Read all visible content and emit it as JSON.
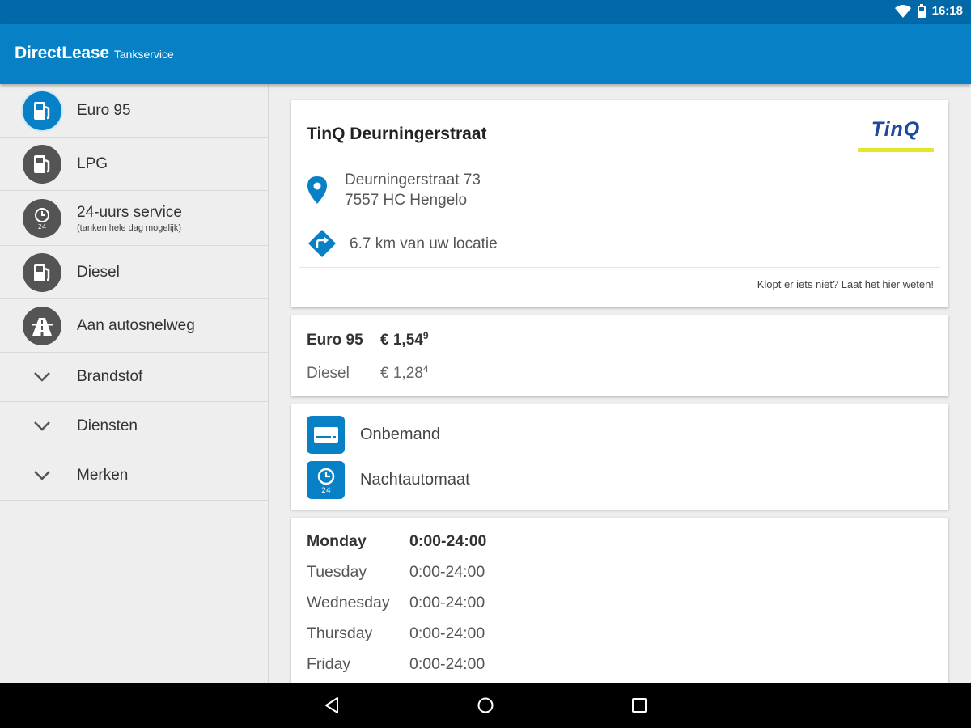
{
  "status_bar": {
    "time": "16:18"
  },
  "app_bar": {
    "brand": "DirectLease",
    "subtitle": "Tankservice"
  },
  "sidebar": {
    "filters": [
      {
        "label": "Euro 95",
        "icon": "fuel-pump-icon",
        "active": true
      },
      {
        "label": "LPG",
        "icon": "fuel-pump-icon",
        "active": false
      },
      {
        "label": "24-uurs service",
        "sublabel": "(tanken hele dag mogelijk)",
        "icon": "clock-24-icon",
        "active": false
      },
      {
        "label": "Diesel",
        "icon": "fuel-pump-icon",
        "active": false
      },
      {
        "label": "Aan autosnelweg",
        "icon": "highway-icon",
        "active": false
      }
    ],
    "sections": [
      {
        "label": "Brandstof"
      },
      {
        "label": "Diensten"
      },
      {
        "label": "Merken"
      }
    ]
  },
  "station": {
    "name": "TinQ Deurningerstraat",
    "logo_text": "TinQ",
    "address_line1": "Deurningerstraat 73",
    "address_line2": "7557 HC  Hengelo",
    "distance": "6.7 km van uw locatie",
    "feedback": "Klopt er iets niet? Laat het hier weten!"
  },
  "prices": [
    {
      "fuel": "Euro 95",
      "price": "€ 1,54",
      "tenth": "9"
    },
    {
      "fuel": "Diesel",
      "price": "€ 1,28",
      "tenth": "4"
    }
  ],
  "services": [
    {
      "label": "Onbemand",
      "icon": "card-icon"
    },
    {
      "label": "Nachtautomaat",
      "icon": "clock-24-icon"
    }
  ],
  "hours": [
    {
      "day": "Monday",
      "time": "0:00-24:00"
    },
    {
      "day": "Tuesday",
      "time": "0:00-24:00"
    },
    {
      "day": "Wednesday",
      "time": "0:00-24:00"
    },
    {
      "day": "Thursday",
      "time": "0:00-24:00"
    },
    {
      "day": "Friday",
      "time": "0:00-24:00"
    }
  ],
  "colors": {
    "primary": "#0780c6",
    "status_bar": "#0169a8",
    "logo_blue": "#1d4a9b",
    "logo_yellow": "#e4e62a"
  }
}
